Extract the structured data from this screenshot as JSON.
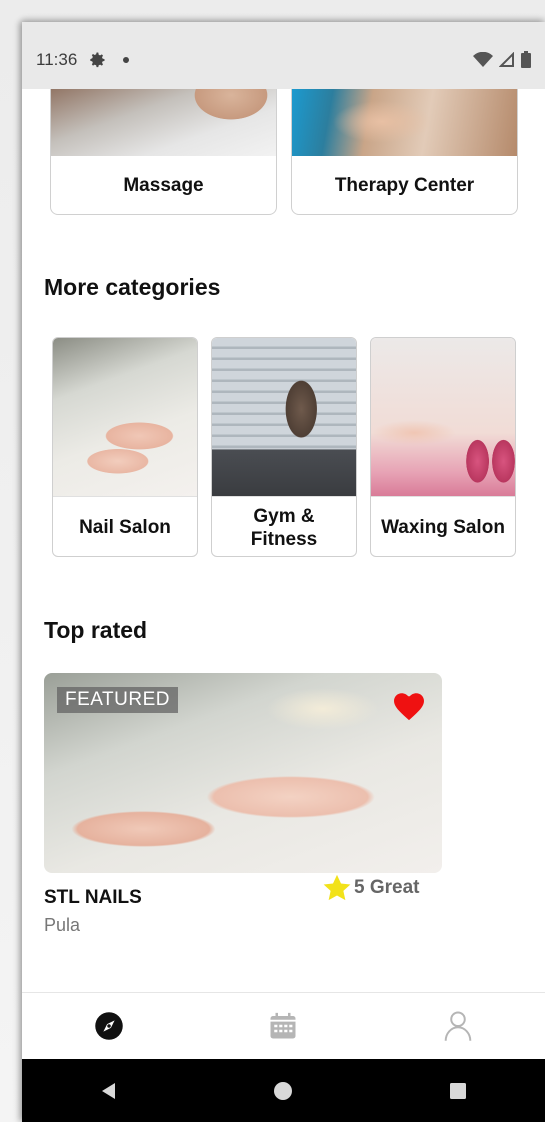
{
  "status_bar": {
    "time": "11:36",
    "icons": [
      "gear-icon",
      "notification-dot-icon",
      "wifi-icon",
      "signal-icon",
      "battery-icon"
    ]
  },
  "top_categories": [
    {
      "label": "Massage"
    },
    {
      "label": "Therapy Center"
    }
  ],
  "more_categories": {
    "title": "More categories",
    "items": [
      {
        "label": "Nail Salon"
      },
      {
        "label": "Gym & Fitness"
      },
      {
        "label": "Waxing Salon"
      }
    ]
  },
  "top_rated": {
    "title": "Top rated",
    "featured": {
      "badge": "FEATURED",
      "name": "STL NAILS",
      "city": "Pula",
      "rating_text": "5 Great",
      "favorited": true
    }
  },
  "bottom_nav": {
    "items": [
      {
        "icon": "compass-icon",
        "active": true
      },
      {
        "icon": "calendar-icon",
        "active": false
      },
      {
        "icon": "profile-icon",
        "active": false
      }
    ]
  },
  "system_nav": {
    "items": [
      "back-icon",
      "home-icon",
      "recents-icon"
    ]
  },
  "colors": {
    "heart": "#ef1111",
    "star": "#f2e21a",
    "active_nav": "#111111",
    "inactive_nav": "#b5b5b5"
  }
}
